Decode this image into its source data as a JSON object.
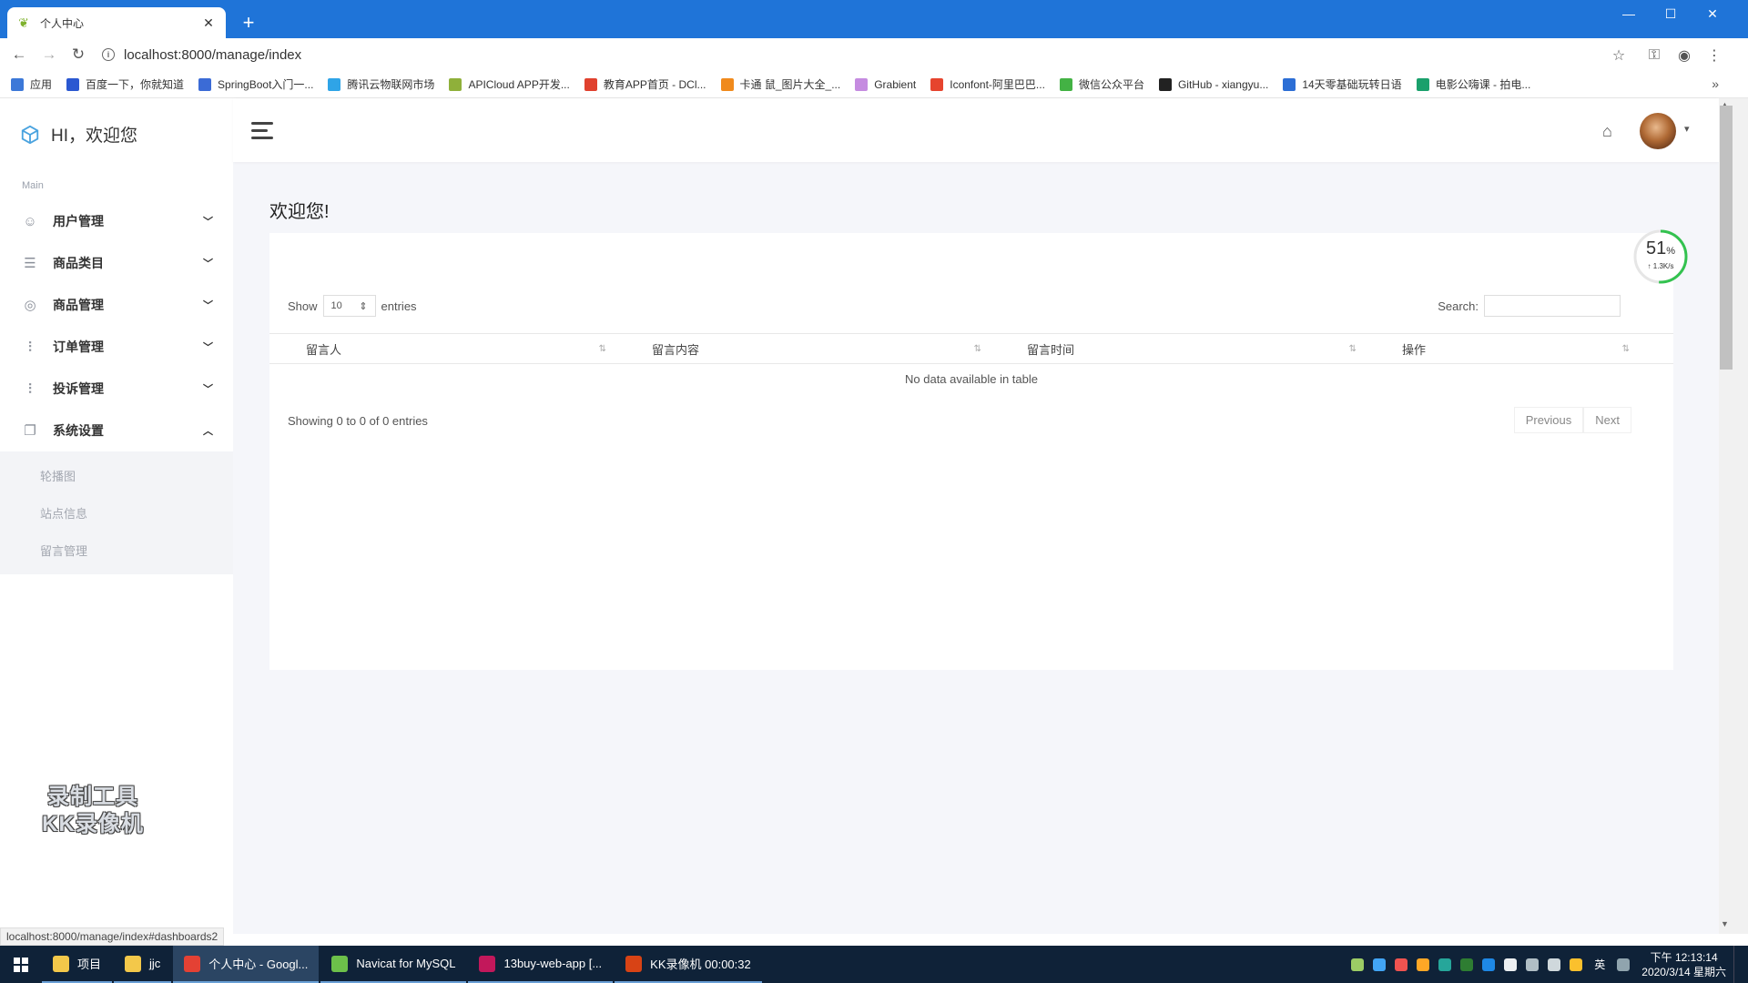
{
  "browser": {
    "tab_title": "个人中心",
    "url": "localhost:8000/manage/index",
    "bookmarks": [
      {
        "label": "应用",
        "color": "#3c78d8"
      },
      {
        "label": "百度一下，你就知道",
        "color": "#2b58d1"
      },
      {
        "label": "SpringBoot入门一...",
        "color": "#3b6bd6"
      },
      {
        "label": "腾讯云物联网市场",
        "color": "#2fa4e7"
      },
      {
        "label": "APICloud APP开发...",
        "color": "#8fb03a"
      },
      {
        "label": "教育APP首页 - DCl...",
        "color": "#e0412e"
      },
      {
        "label": "卡通 鼠_图片大全_...",
        "color": "#f08a1c"
      },
      {
        "label": "Grabient",
        "color": "#c58be0"
      },
      {
        "label": "Iconfont-阿里巴巴...",
        "color": "#e6442e"
      },
      {
        "label": "微信公众平台",
        "color": "#43b244"
      },
      {
        "label": "GitHub - xiangyu...",
        "color": "#222222"
      },
      {
        "label": "14天零基础玩转日语",
        "color": "#2c6ed5"
      },
      {
        "label": "电影公嗨课 - 拍电...",
        "color": "#1aa06c"
      }
    ],
    "status_url": "localhost:8000/manage/index#dashboards2"
  },
  "sidebar": {
    "brand": "HI，欢迎您",
    "section_label": "Main",
    "items": [
      {
        "label": "用户管理",
        "icon": "users-icon",
        "glyph": "☺",
        "expanded": false
      },
      {
        "label": "商品类目",
        "icon": "list-icon",
        "glyph": "☰",
        "expanded": false
      },
      {
        "label": "商品管理",
        "icon": "grid-circle-icon",
        "glyph": "◎",
        "expanded": false
      },
      {
        "label": "订单管理",
        "icon": "sliders-icon",
        "glyph": "⫶",
        "expanded": false
      },
      {
        "label": "投诉管理",
        "icon": "sliders-icon",
        "glyph": "⫶",
        "expanded": false
      },
      {
        "label": "系统设置",
        "icon": "copy-icon",
        "glyph": "❐",
        "expanded": true
      }
    ],
    "submenu": [
      "轮播图",
      "站点信息",
      "留言管理"
    ]
  },
  "watermark": {
    "line1": "录制工具",
    "line2": "KK录像机"
  },
  "main": {
    "welcome": "欢迎您!",
    "gauge": {
      "percent": "51",
      "unit": "%",
      "speed": "↑ 1.3K/s",
      "value": 0.51,
      "color": "#33c24f"
    },
    "table": {
      "show_label": "Show",
      "page_size": "10",
      "entries_label": "entries",
      "search_label": "Search:",
      "columns": [
        "留言人",
        "留言内容",
        "留言时间",
        "操作"
      ],
      "empty_message": "No data available in table",
      "info": "Showing 0 to 0 of 0 entries",
      "prev": "Previous",
      "next": "Next"
    }
  },
  "taskbar": {
    "items": [
      {
        "label": "项目",
        "color": "#f3c84a",
        "active": false
      },
      {
        "label": "jjc",
        "color": "#f3c84a",
        "active": false
      },
      {
        "label": "个人中心 - Googl...",
        "color": "#e44134",
        "active": true
      },
      {
        "label": "Navicat for MySQL",
        "color": "#6cc04a",
        "active": false
      },
      {
        "label": "13buy-web-app [...",
        "color": "#c2185b",
        "active": false
      },
      {
        "label": "KK录像机 00:00:32",
        "color": "#d84315",
        "active": false
      }
    ],
    "ime": "英",
    "time": "下午 12:13:14",
    "date": "2020/3/14 星期六"
  }
}
